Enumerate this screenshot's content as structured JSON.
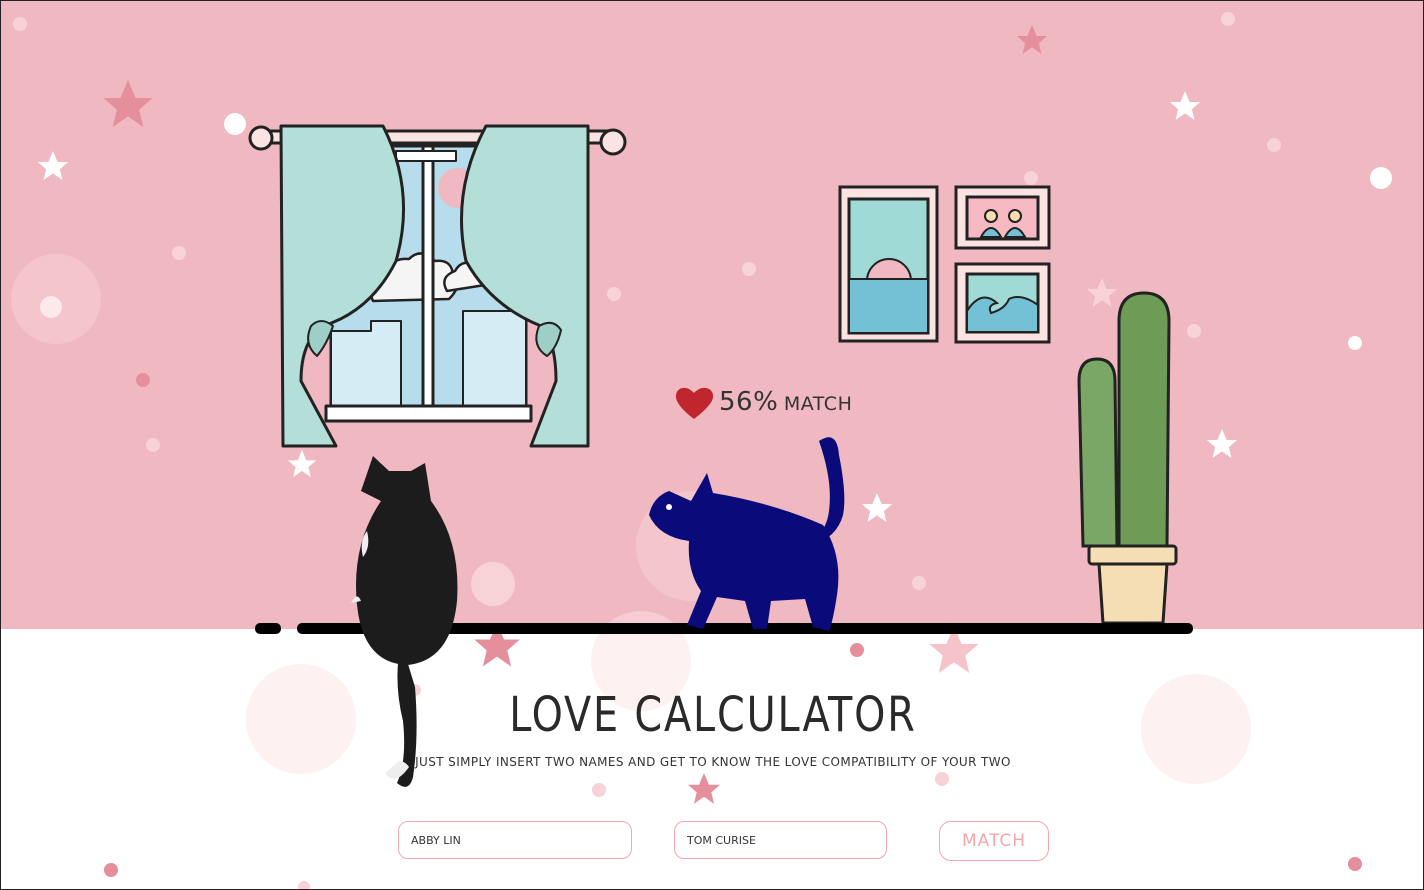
{
  "result": {
    "percent": "56%",
    "label": "MATCH"
  },
  "title": "LOVE CALCULATOR",
  "subtitle": "JUST SIMPLY INSERT TWO NAMES AND GET TO KNOW THE LOVE COMPATIBILITY OF YOUR TWO",
  "form": {
    "name1_value": "ABBY LIN",
    "name2_value": "TOM CURISE",
    "button_label": "MATCH"
  },
  "colors": {
    "wall": "#f0b8c0",
    "accent": "#f3a7ab",
    "heart": "#c0262d",
    "blue_cat": "#0a0a7a"
  }
}
